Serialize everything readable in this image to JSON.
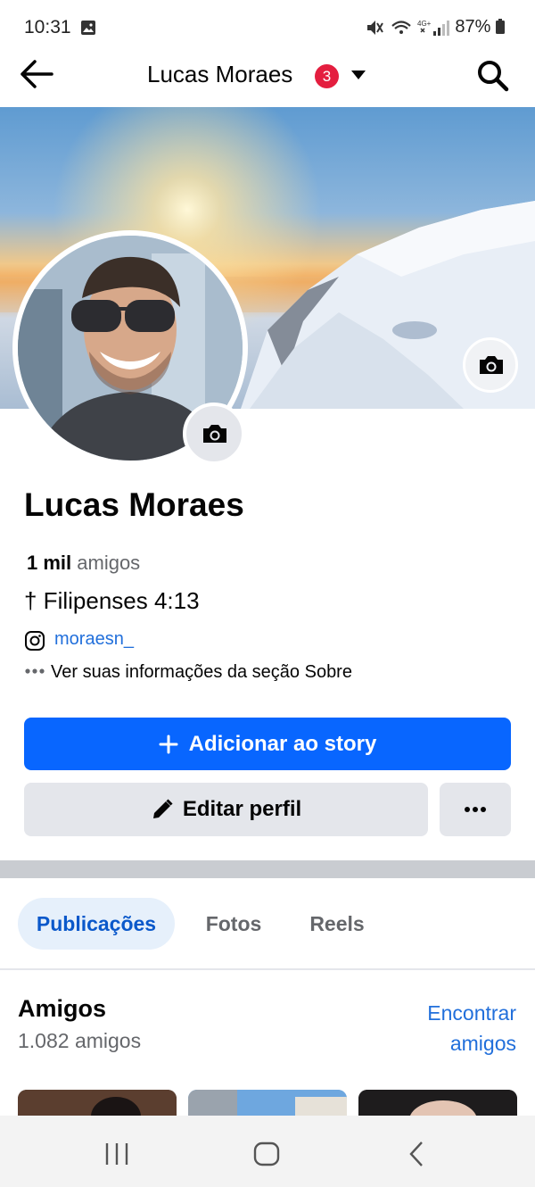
{
  "status_bar": {
    "time": "10:31",
    "battery": "87%"
  },
  "header": {
    "title": "Lucas Moraes",
    "notification_count": "3"
  },
  "profile": {
    "name": "Lucas Moraes",
    "friends_count": "1 mil",
    "friends_label": "amigos",
    "bio": "† Filipenses 4:13",
    "instagram": "moraesn_",
    "about_link": "Ver suas informações da seção Sobre"
  },
  "actions": {
    "add_story": "Adicionar ao story",
    "edit_profile": "Editar perfil"
  },
  "tabs": [
    {
      "label": "Publicações",
      "active": true
    },
    {
      "label": "Fotos",
      "active": false
    },
    {
      "label": "Reels",
      "active": false
    }
  ],
  "friends_section": {
    "title": "Amigos",
    "count": "1.082 amigos",
    "find_line1": "Encontrar",
    "find_line2": "amigos"
  },
  "colors": {
    "accent": "#0866ff",
    "link": "#216fdb",
    "badge": "#e41e3f"
  }
}
